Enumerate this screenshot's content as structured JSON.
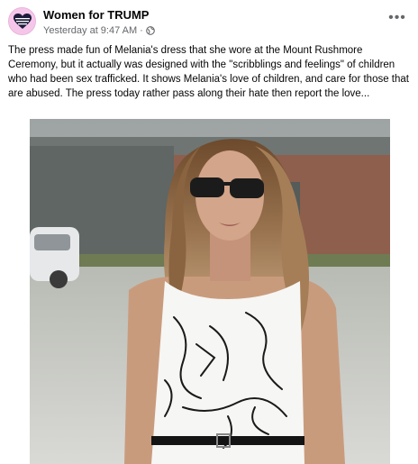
{
  "post": {
    "page_name": "Women for TRUMP",
    "timestamp": "Yesterday at 9:47 AM",
    "separator": "·",
    "audience_icon": "globe-icon",
    "more_icon": "more-options-icon",
    "text": "The press made fun of Melania's dress that she wore at the Mount Rushmore Ceremony, but it actually was designed with the \"scribblings and feelings\" of children who had been sex trafficked. It shows Melania's love of  children, and care for those that are abused. The press today rather pass along their hate then report the love...",
    "photo_subject": "woman-in-sunglasses-white-sketch-print-dress",
    "avatar_icon": "heart-flag-icon"
  },
  "colors": {
    "avatar_bg": "#f6c6ea",
    "meta_text": "#65676b",
    "text": "#050505"
  }
}
